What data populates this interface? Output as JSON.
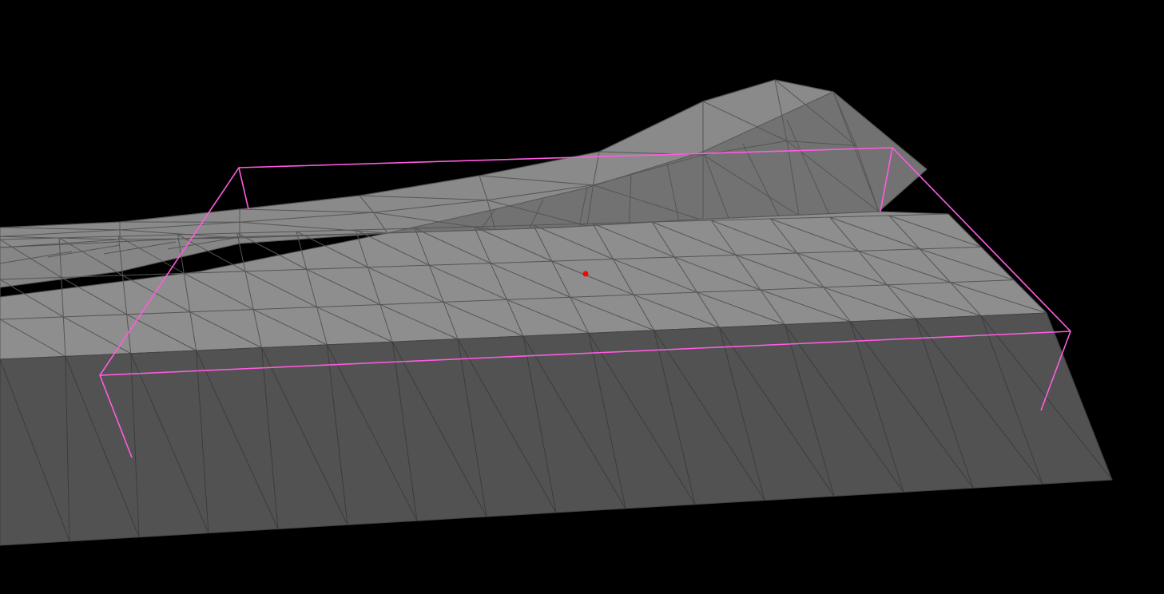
{
  "viewport": {
    "background": "#000000",
    "mesh_top_color": "#8e8e8e",
    "mesh_side_color": "#525252",
    "mesh_edge_color": "#555555",
    "selection_color": "#ff5ce0",
    "marker_color": "#ff0000",
    "icons": {
      "marker": "pivot-point-icon"
    }
  }
}
